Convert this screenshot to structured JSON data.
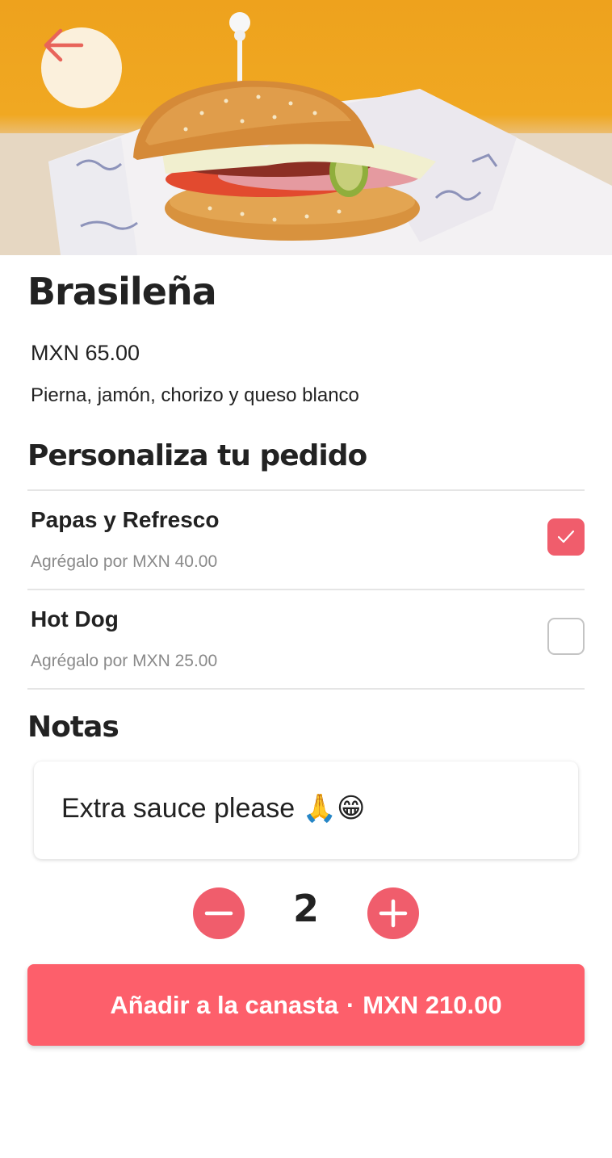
{
  "product": {
    "name": "Brasileña",
    "price": "MXN 65.00",
    "description": "Pierna, jamón, chorizo y queso blanco",
    "image_icon": "sandwich-photo"
  },
  "navigation": {
    "back_icon": "arrow-left-icon"
  },
  "customize": {
    "title": "Personaliza tu pedido",
    "options": [
      {
        "name": "Papas y Refresco",
        "subtitle": "Agrégalo por MXN 40.00",
        "checked": true
      },
      {
        "name": "Hot Dog",
        "subtitle": "Agrégalo por MXN 25.00",
        "checked": false
      }
    ]
  },
  "notes": {
    "title": "Notas",
    "value": "Extra sauce please 🙏😁"
  },
  "quantity": {
    "value": "2",
    "decrement_icon": "minus-icon",
    "increment_icon": "plus-icon"
  },
  "add_button": {
    "label": "Añadir a la canasta",
    "separator": "·",
    "total": "MXN 210.00"
  },
  "colors": {
    "accent": "#f05d6c",
    "button": "#fd5f6b",
    "back_button_bg": "#fbf0dc",
    "back_arrow": "#e8645a",
    "text": "#222222",
    "muted_text": "#8a8a8a"
  }
}
